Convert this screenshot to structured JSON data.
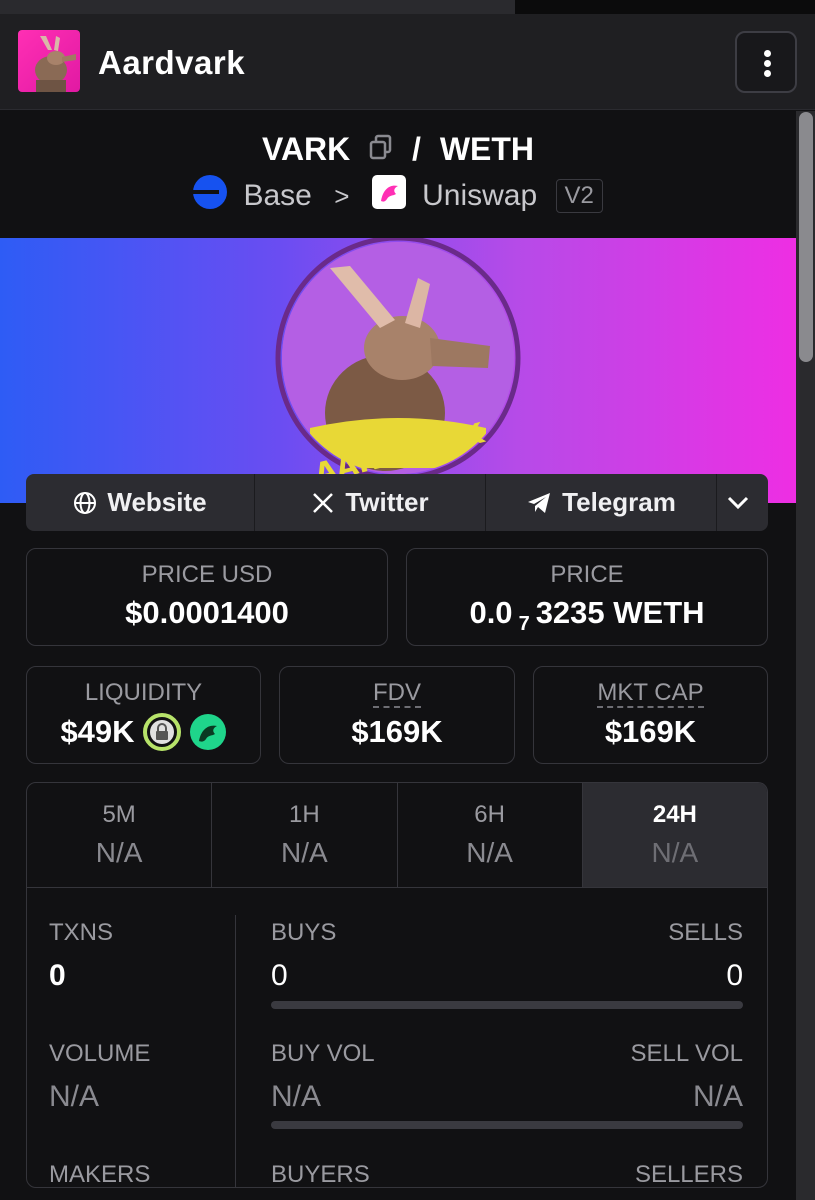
{
  "header": {
    "title": "Aardvark"
  },
  "pair": {
    "base": "VARK",
    "separator": "/",
    "quote": "WETH"
  },
  "chain": {
    "network": "Base",
    "arrow": ">",
    "dex": "Uniswap",
    "version": "V2"
  },
  "banner": {
    "logo_text": "AARDVARK"
  },
  "links": [
    {
      "label": "Website",
      "icon": "globe-icon"
    },
    {
      "label": "Twitter",
      "icon": "x-icon"
    },
    {
      "label": "Telegram",
      "icon": "telegram-icon"
    }
  ],
  "price": {
    "usd_label": "PRICE USD",
    "usd_value": "$0.0001400",
    "native_label": "PRICE",
    "native_prefix": "0.0",
    "native_sub": "7",
    "native_rest": "3235 WETH"
  },
  "metrics": {
    "liquidity_label": "LIQUIDITY",
    "liquidity_value": "$49K",
    "fdv_label": "FDV",
    "fdv_value": "$169K",
    "mcap_label": "MKT CAP",
    "mcap_value": "$169K"
  },
  "tabs": [
    {
      "label": "5M",
      "value": "N/A"
    },
    {
      "label": "1H",
      "value": "N/A"
    },
    {
      "label": "6H",
      "value": "N/A"
    },
    {
      "label": "24H",
      "value": "N/A"
    }
  ],
  "stats": {
    "txns_label": "TXNS",
    "txns_value": "0",
    "buys_label": "BUYS",
    "buys_value": "0",
    "sells_label": "SELLS",
    "sells_value": "0",
    "volume_label": "VOLUME",
    "volume_value": "N/A",
    "buyvol_label": "BUY VOL",
    "buyvol_value": "N/A",
    "sellvol_label": "SELL VOL",
    "sellvol_value": "N/A",
    "makers_label": "MAKERS",
    "buyers_label": "BUYERS",
    "sellers_label": "SELLERS"
  },
  "colors": {
    "accent_pink": "#ee2ee3",
    "accent_blue": "#2e5cf5",
    "base_blue": "#1652f0",
    "lock_green": "#b7e36a",
    "uni_green": "#1fd58b"
  }
}
